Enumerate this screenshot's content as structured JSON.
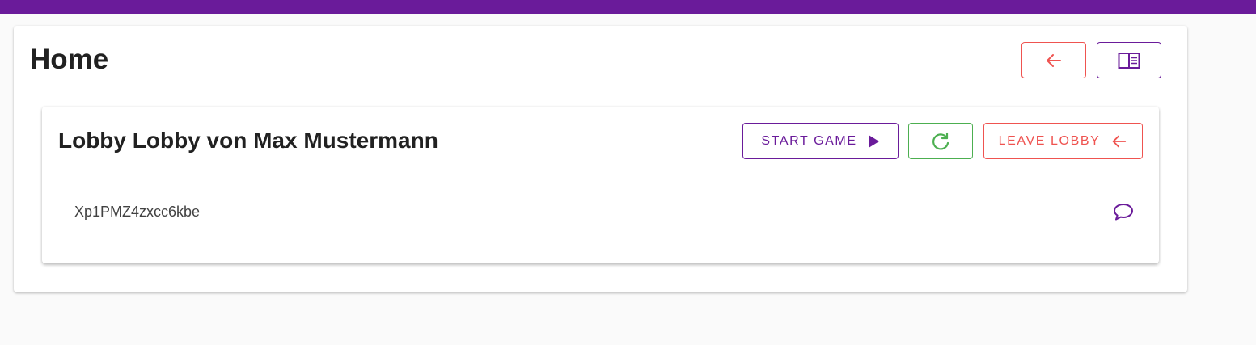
{
  "header": {
    "title": "Home"
  },
  "toolbar": {
    "back_icon": "arrow-left-icon",
    "sidebar_icon": "sidebar-toggle-icon"
  },
  "lobby": {
    "title": "Lobby Lobby von Max Mustermann",
    "start_label": "START GAME",
    "leave_label": "LEAVE LOBBY",
    "players": [
      {
        "name": "Xp1PMZ4zxcc6kbe"
      }
    ]
  },
  "colors": {
    "primary": "#6a1b9a",
    "danger": "#ef5350",
    "success": "#4caf50"
  }
}
